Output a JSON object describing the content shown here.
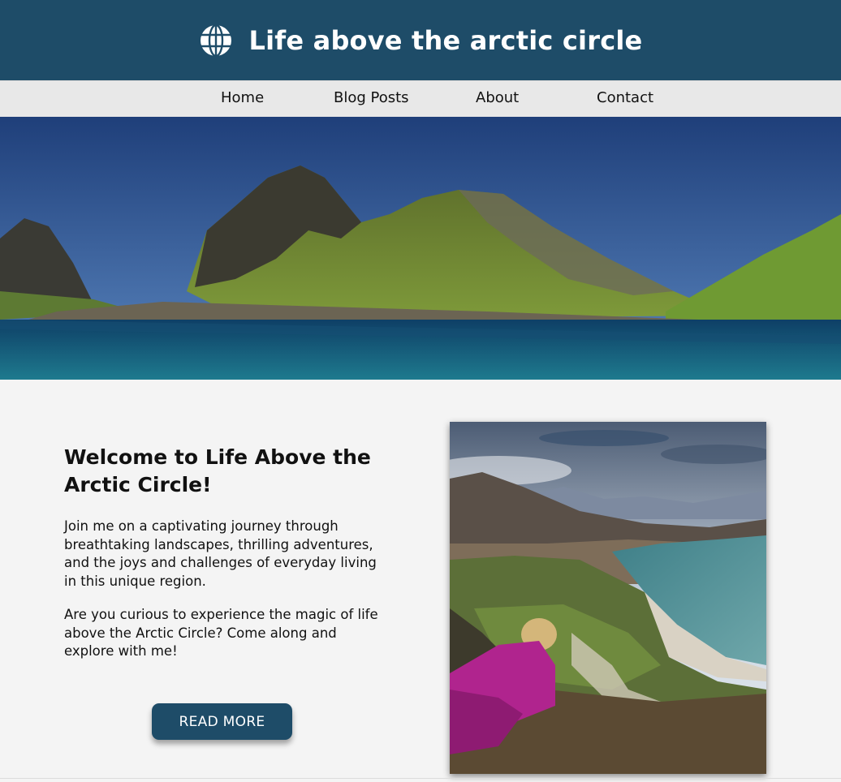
{
  "site": {
    "title": "Life above the arctic circle",
    "logo_icon": "globe-icon"
  },
  "nav": {
    "items": [
      {
        "label": "Home"
      },
      {
        "label": "Blog Posts"
      },
      {
        "label": "About"
      },
      {
        "label": "Contact"
      }
    ]
  },
  "main": {
    "heading": "Welcome to Life Above the Arctic Circle!",
    "paragraphs": [
      "Join me on a captivating journey through breathtaking landscapes, thrilling adventures, and the joys and challenges of everyday living in this unique region.",
      "Are you curious to experience the magic of life above the Arctic Circle? Come along and explore with me!"
    ],
    "button_label": "READ MORE"
  },
  "colors": {
    "brand": "#1e4c68",
    "nav_bg": "#e8e8e8",
    "page_bg": "#f4f4f4",
    "button_text": "#ffffff"
  }
}
